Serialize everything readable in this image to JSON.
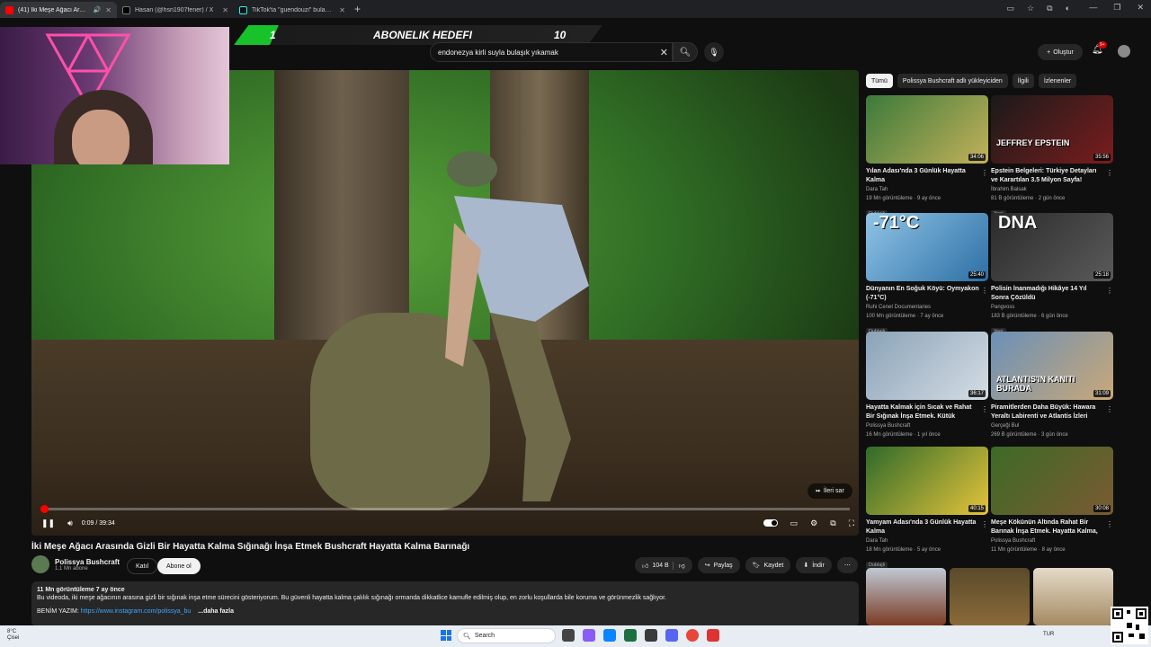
{
  "browser": {
    "tabs": [
      {
        "label": "(41) İki Meşe Ağacı Arasında",
        "active": true,
        "favicon_color": "#ff0000"
      },
      {
        "label": "Hasan (@hsn1907fener) / X",
        "active": false,
        "favicon_color": "#ffffff"
      },
      {
        "label": "TikTok'ta \"guendouzi\" bulabilirsin",
        "active": false,
        "favicon_color": "#111111"
      }
    ]
  },
  "overlay": {
    "goal_title": "ABONELIK HEDEFI",
    "goal_current": "1",
    "goal_target": "10"
  },
  "search": {
    "value": "endonezya kirli suyla bulaşık yıkamak"
  },
  "header": {
    "create_label": "Oluştur",
    "notif_badge": "9+"
  },
  "player": {
    "skip_label": "İleri sar",
    "time": "0:09 / 39:34",
    "progress_fraction": 0.004
  },
  "video": {
    "title": "İki Meşe Ağacı Arasında Gizli Bir Hayatta Kalma Sığınağı İnşa Etmek Bushcraft Hayatta Kalma Barınağı",
    "channel": "Polissya Bushcraft",
    "subs": "1,1 Mn abone",
    "join_label": "Katıl",
    "subscribe_label": "Abone ol",
    "likes": "104 B",
    "share_label": "Paylaş",
    "save_label": "Kaydet",
    "download_label": "İndir"
  },
  "description": {
    "meta": "11 Mn görüntüleme  7 ay önce",
    "body": "Bu videoda, iki meşe ağacının arasına gizli bir sığınak inşa etme sürecini gösteriyorum. Bu güvenli hayatta kalma çalılık sığınağı ormanda dikkatlice kamufle edilmiş olup, en zorlu koşullarda bile koruma ve görünmezlik sağlıyor.",
    "link_prefix": "BENİM YAZIM:",
    "link": "https://www.instagram.com/polissya_bu",
    "more": "...daha fazla"
  },
  "chips": [
    "Tümü",
    "Polissya Bushcraft adlı yükleyiciden",
    "İlgili",
    "İzlenenler"
  ],
  "recommendations": [
    {
      "title": "Yılan Adası'nda 3 Günlük Hayatta Kalma",
      "channel": "Dara Tah",
      "meta": "19 Mn görüntüleme · 9 ay önce",
      "tag": "Dublajlı",
      "duration": "34:06",
      "overlay": "",
      "color1": "#3b7a3a",
      "color2": "#c3b15a"
    },
    {
      "title": "Epstein Belgeleri: Türkiye Detayları ve Karartılan 3.5 Milyon Sayfa!",
      "channel": "İbrahim Balsak",
      "meta": "81 B görüntüleme · 2 gün önce",
      "tag": "Yeni",
      "duration": "35:56",
      "overlay": "JEFFREY EPSTEIN",
      "color1": "#1a1a1a",
      "color2": "#7a1d1d"
    },
    {
      "title": "Dünyanın En Soğuk Köyü: Oymyakon (-71°C)",
      "channel": "Ruhi Cenet Documentaries",
      "meta": "100 Mn görüntüleme · 7 ay önce",
      "tag": "Dublajlı",
      "duration": "25:40",
      "overlay": "-71°C",
      "color1": "#8fc4e6",
      "color2": "#2d6fa5"
    },
    {
      "title": "Polisin İnanmadığı Hikâye 14 Yıl Sonra Çözüldü",
      "channel": "Pangvoss",
      "meta": "183 B görüntüleme · 6 gün önce",
      "tag": "Yeni",
      "duration": "25:18",
      "overlay": "DNA",
      "color1": "#2b2b2b",
      "color2": "#5a5a5a"
    },
    {
      "title": "Hayatta Kalmak için Sıcak ve Rahat Bir Sığınak İnşa Etmek. Kütük Barınak Gi...",
      "channel": "Polissya Bushcraft",
      "meta": "16 Mn görüntüleme · 1 yıl önce",
      "tag": "",
      "duration": "36:17",
      "overlay": "",
      "color1": "#8aa3b8",
      "color2": "#d5dde4"
    },
    {
      "title": "Piramitlerden Daha Büyük: Hawara Yeraltı Labirenti ve Atlantis İzleri",
      "channel": "Gerçeği Bul",
      "meta": "269 B görüntüleme · 3 gün önce",
      "tag": "Yeni",
      "duration": "31:09",
      "overlay": "ATLANTIS'IN KANITI BURADA",
      "color1": "#6a90b8",
      "color2": "#c9a878"
    },
    {
      "title": "Yamyam Adası'nda 3 Günlük Hayatta Kalma",
      "channel": "Dara Tah",
      "meta": "18 Mn görüntüleme · 5 ay önce",
      "tag": "Dublajlı",
      "duration": "40:15",
      "overlay": "",
      "color1": "#2f6a2a",
      "color2": "#e5c43a"
    },
    {
      "title": "Meşe Kökünün Altında Rahat Bir Barınak İnşa Etmek. Hayatta Kalma, ...",
      "channel": "Polissya Bushcraft",
      "meta": "11 Mn görüntüleme · 8 ay önce",
      "tag": "",
      "duration": "30:08",
      "overlay": "",
      "color1": "#3d6a26",
      "color2": "#7a5a32"
    }
  ],
  "taskbar": {
    "weather_temp": "8°C",
    "weather_desc": "Çisei",
    "search_placeholder": "Search",
    "lang": "TUR"
  }
}
